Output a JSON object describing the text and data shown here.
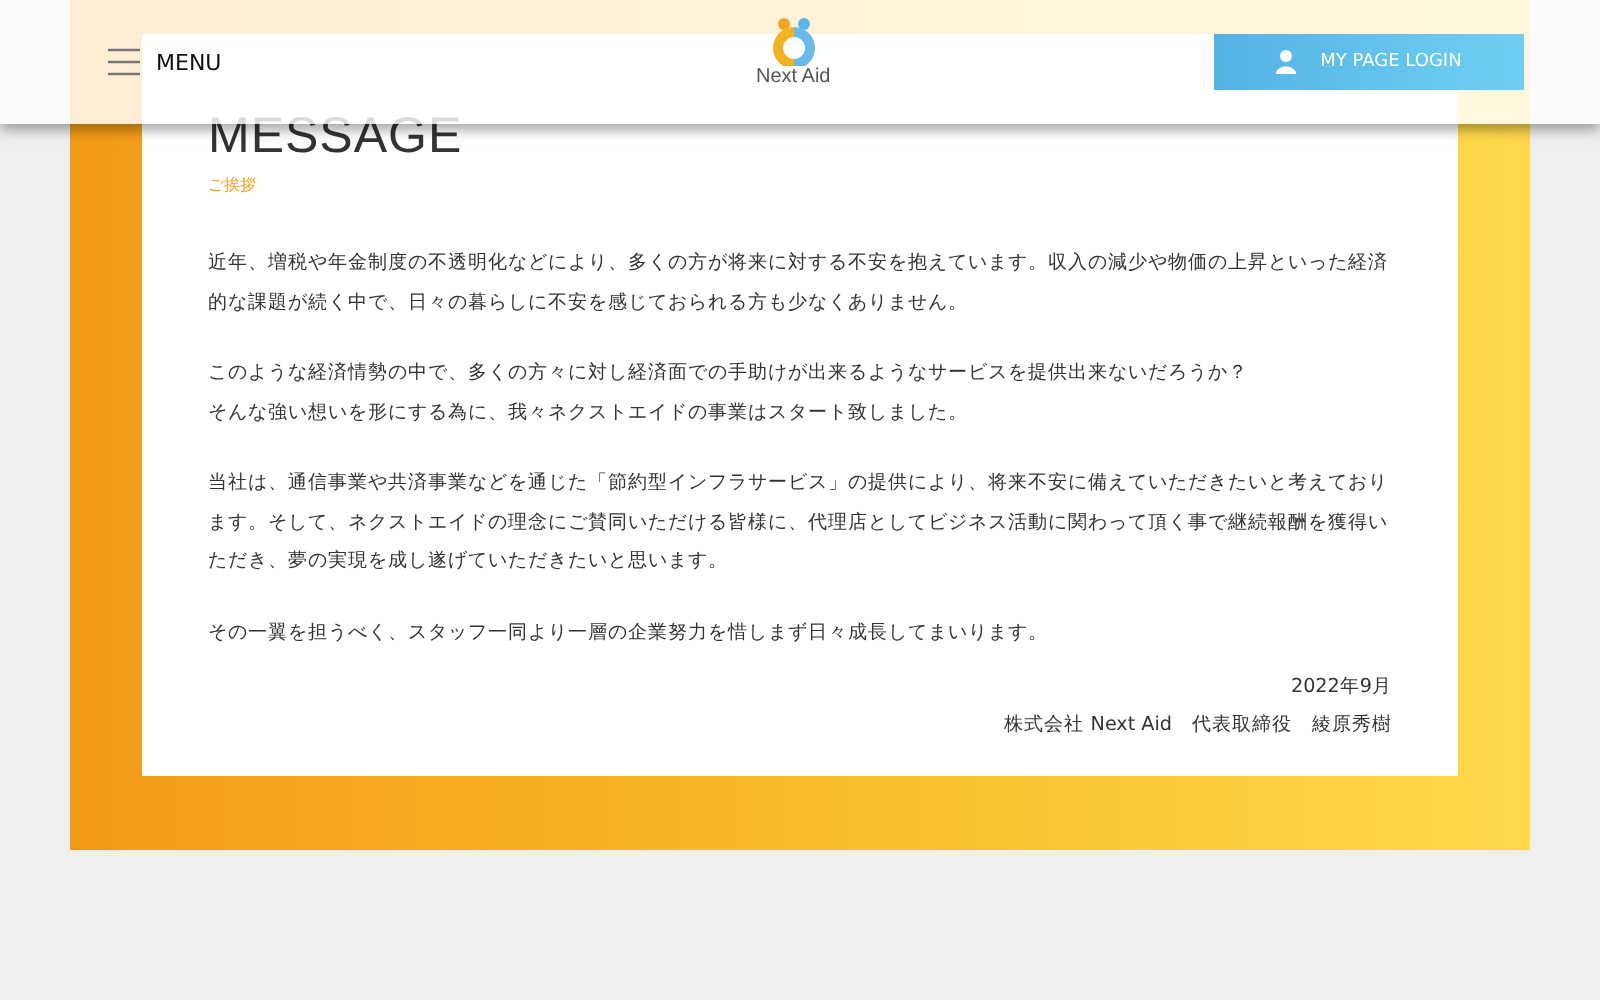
{
  "header": {
    "menu_label": "MENU",
    "logo_text": "Next Aid",
    "login_button": "MY PAGE LOGIN"
  },
  "message": {
    "title": "MESSAGE",
    "subtitle": "ご挨拶",
    "paragraphs": [
      [
        "近年、増税や年金制度の不透明化などにより、多くの方が将来に対する不安を抱えています。収入の減少や物価の上昇といった経済的な課題が続く中で、日々の暮らしに不安を感じておられる方も少なくありません。"
      ],
      [
        "このような経済情勢の中で、多くの方々に対し経済面での手助けが出来るようなサービスを提供出来ないだろうか？",
        "そんな強い想いを形にする為に、我々ネクストエイドの事業はスタート致しました。"
      ],
      [
        "当社は、通信事業や共済事業などを通じた「節約型インフラサービス」の提供により、将来不安に備えていただきたいと考えております。そして、ネクストエイドの理念にご賛同いただける皆様に、代理店としてビジネス活動に関わって頂く事で継続報酬を獲得いただき、夢の実現を成し遂げていただきたいと思います。"
      ],
      [
        "その一翼を担うべく、スタッフ一同より一層の企業努力を惜しまず日々成長してまいります。"
      ]
    ],
    "date": "2022年9月",
    "signature": "株式会社 Next Aid　代表取締役　綾原秀樹"
  }
}
